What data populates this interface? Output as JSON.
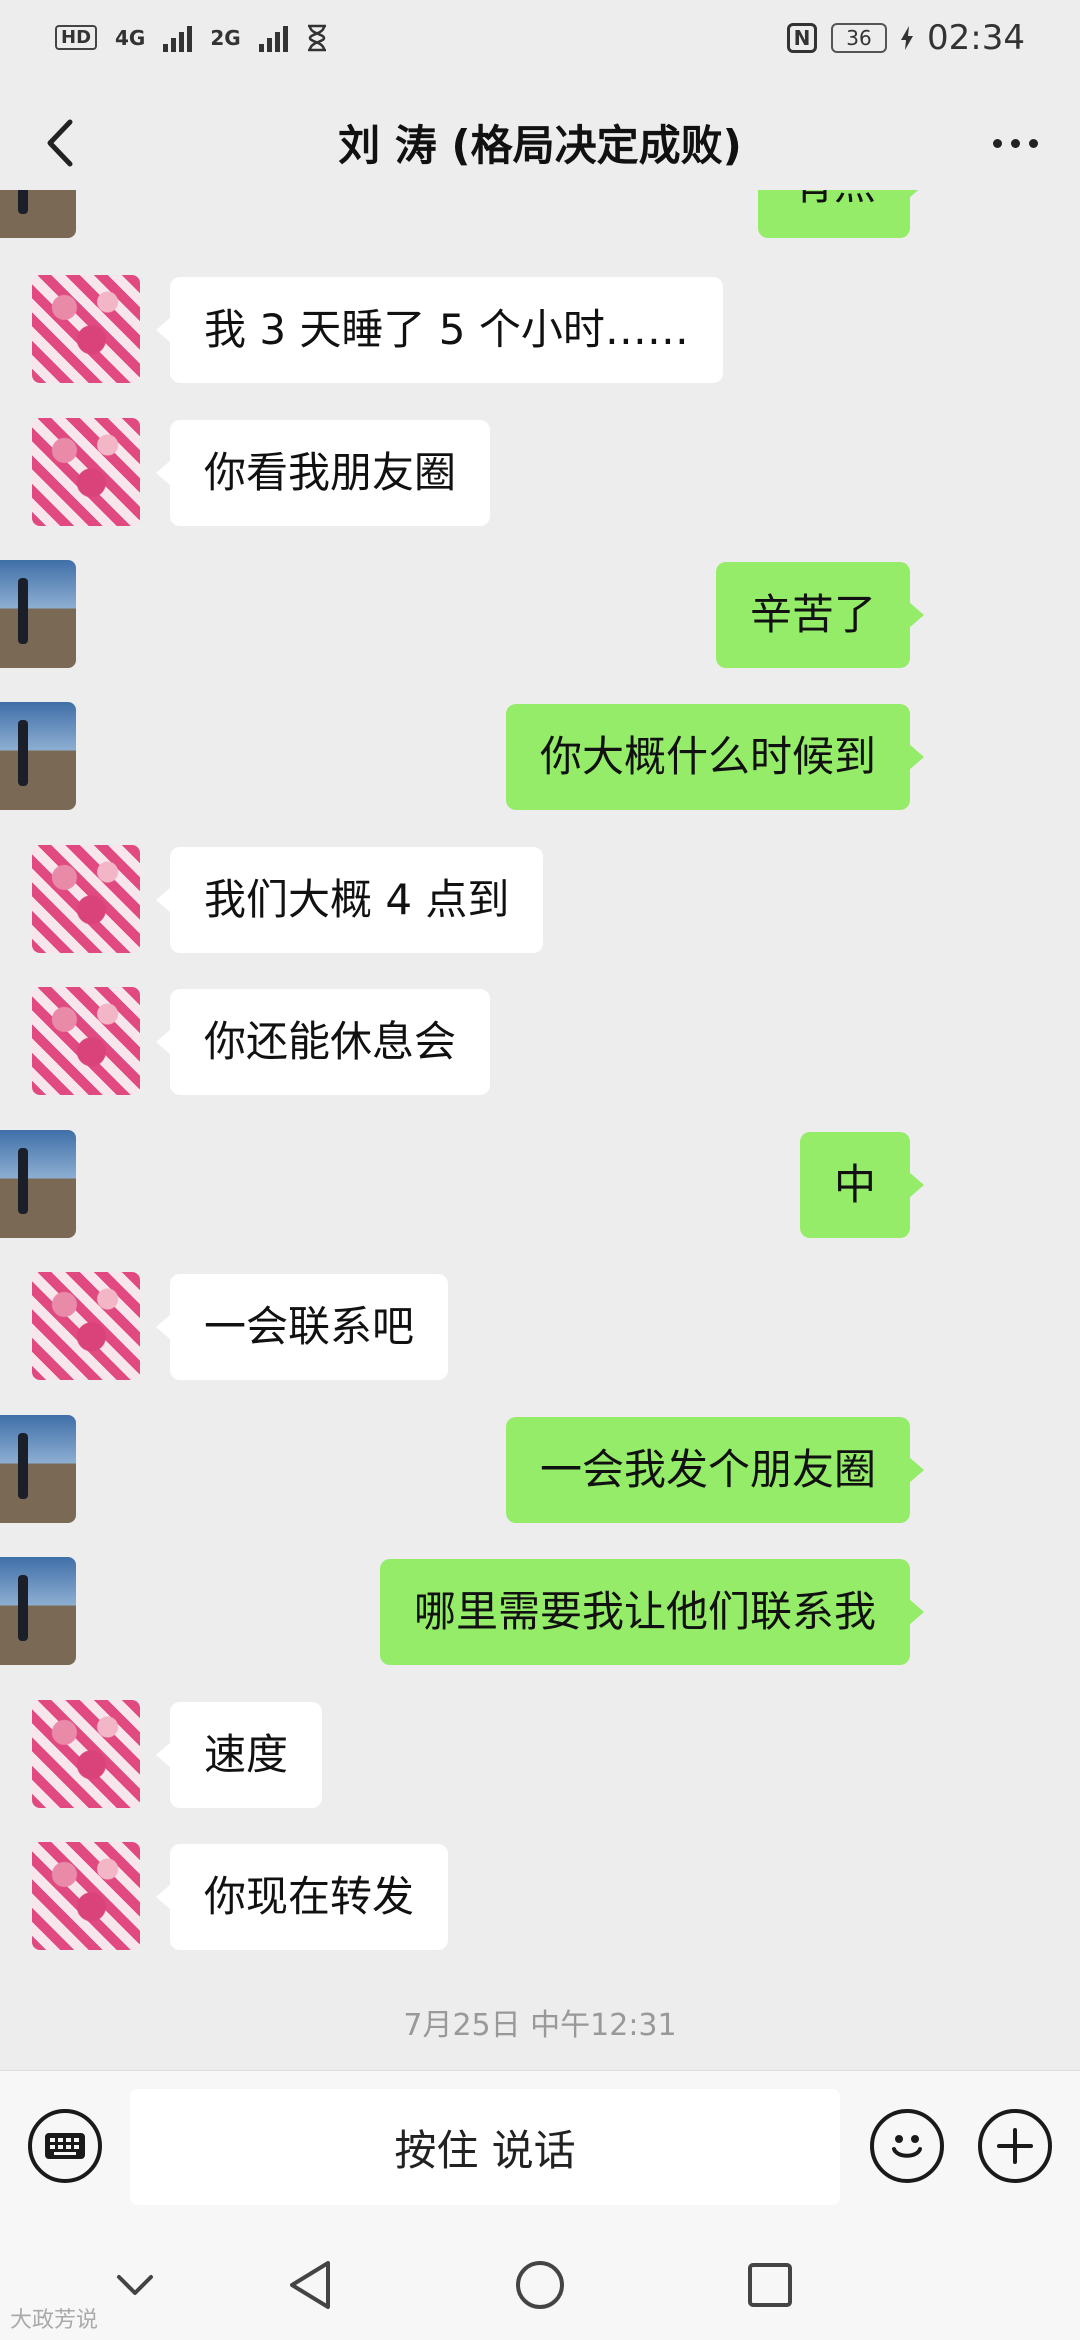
{
  "status_bar": {
    "left_label_1": "HD",
    "left_label_2": "4G",
    "left_label_3": "2G",
    "battery": "36",
    "time": "02:34"
  },
  "header": {
    "title": "刘 涛 (格局决定成败)"
  },
  "messages": [
    {
      "side": "right",
      "text": "有点"
    },
    {
      "side": "left",
      "text": "我 3 天睡了 5 个小时……"
    },
    {
      "side": "left",
      "text": "你看我朋友圈"
    },
    {
      "side": "right",
      "text": "辛苦了"
    },
    {
      "side": "right",
      "text": "你大概什么时候到"
    },
    {
      "side": "left",
      "text": "我们大概 4 点到"
    },
    {
      "side": "left",
      "text": "你还能休息会"
    },
    {
      "side": "right",
      "text": "中"
    },
    {
      "side": "left",
      "text": "一会联系吧"
    },
    {
      "side": "right",
      "text": "一会我发个朋友圈"
    },
    {
      "side": "right",
      "text": "哪里需要我让他们联系我"
    },
    {
      "side": "left",
      "text": "速度"
    },
    {
      "side": "left",
      "text": "你现在转发"
    }
  ],
  "timestamp": "7月25日 中午12:31",
  "input_bar": {
    "hold_to_talk": "按住 说话"
  },
  "watermark": "大政芳说",
  "colors": {
    "background": "#ededed",
    "own_bubble": "#95ec69",
    "other_bubble": "#ffffff"
  },
  "icons": [
    "back-arrow-icon",
    "more-dots-icon",
    "keyboard-icon",
    "emoji-icon",
    "plus-icon",
    "nav-down-icon",
    "nav-back-icon",
    "nav-home-icon",
    "nav-recents-icon"
  ]
}
